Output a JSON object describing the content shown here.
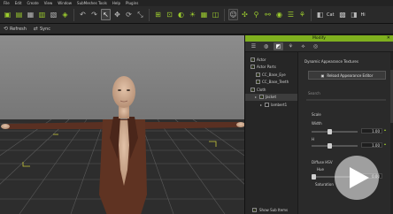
{
  "menubar": {
    "items": [
      "File",
      "Edit",
      "Create",
      "View",
      "Window",
      "SubMeshes Tools",
      "Help",
      "Plugins"
    ]
  },
  "toolbar": {
    "cat_label": "Cat",
    "hi_label": "Hi"
  },
  "subtoolbar": {
    "refresh_label": "Refresh",
    "sync_label": "Sync"
  },
  "panel": {
    "title": "Modify",
    "tree": {
      "items": [
        {
          "label": "Actor",
          "checked": true,
          "indent": 0,
          "expander": ""
        },
        {
          "label": "Actor Parts",
          "checked": true,
          "indent": 0,
          "expander": ""
        },
        {
          "label": "CC_Base_Eye",
          "checked": true,
          "indent": 1,
          "expander": ""
        },
        {
          "label": "CC_Base_Teeth",
          "checked": true,
          "indent": 1,
          "expander": ""
        },
        {
          "label": "Cloth",
          "checked": true,
          "indent": 0,
          "expander": ""
        },
        {
          "label": "Jacket",
          "checked": true,
          "indent": 1,
          "expander": "▸",
          "selected": true
        },
        {
          "label": "lambert1",
          "checked": false,
          "indent": 2,
          "expander": "▸"
        }
      ],
      "show_sub_items_label": "Show Sub Items"
    },
    "properties": {
      "section_title": "Dynamic Appearance Textures",
      "edit_button_label": "Reload Appearance Editor",
      "search_placeholder": "Search",
      "scale_label": "Scale",
      "width_label": "Width",
      "width_value": "1.00",
      "h_label": "H",
      "h_value": "1.00",
      "diffuse_label": "Diffuse HSV",
      "hue_label": "Hue",
      "hue_value": "0.00",
      "saturation_label": "Saturation"
    }
  },
  "colors": {
    "accent": "#7fb01e",
    "viewport_sky": "#7a7a7a",
    "grid_floor": "#333333"
  }
}
